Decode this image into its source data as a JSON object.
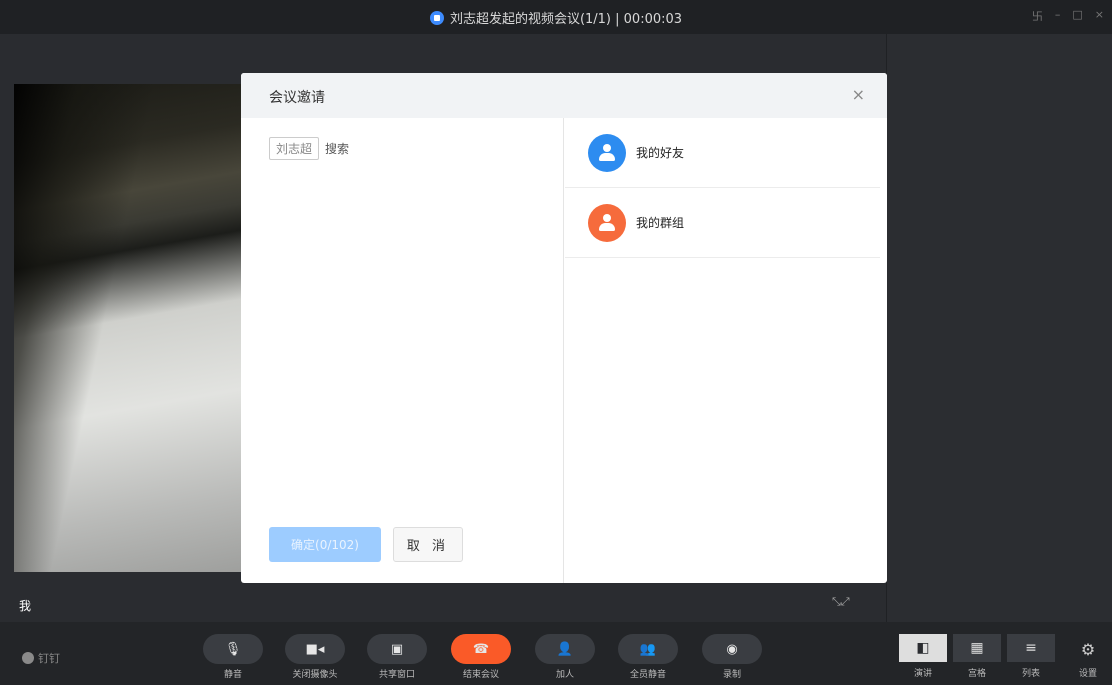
{
  "titlebar": {
    "title": "刘志超发起的视频会议(1/1) | 00:00:03",
    "window_controls": [
      "卐",
      "–",
      "□",
      "×"
    ]
  },
  "video": {
    "self_label": "我"
  },
  "bottombar": {
    "brand": "钉钉",
    "controls": [
      {
        "label": "静音",
        "icon": "microphone-icon"
      },
      {
        "label": "关闭摄像头",
        "icon": "camera-icon"
      },
      {
        "label": "共享窗口",
        "icon": "share-window-icon"
      },
      {
        "label": "结束会议",
        "icon": "hangup-icon"
      },
      {
        "label": "加人",
        "icon": "add-person-icon"
      },
      {
        "label": "全员静音",
        "icon": "mute-all-icon"
      },
      {
        "label": "录制",
        "icon": "record-icon"
      }
    ],
    "layouts": [
      {
        "label": "演讲",
        "icon": "speaker-layout-icon",
        "active": true
      },
      {
        "label": "宫格",
        "icon": "grid-layout-icon",
        "active": false
      },
      {
        "label": "列表",
        "icon": "list-layout-icon",
        "active": false
      }
    ],
    "settings_label": "设置"
  },
  "dialog": {
    "title": "会议邀请",
    "selected_chip": "刘志超",
    "search_placeholder": "搜索",
    "confirm_label": "确定(0/102)",
    "cancel_label": "取 消",
    "groups": [
      {
        "name": "我的好友",
        "color": "#2d8cf0"
      },
      {
        "name": "我的群组",
        "color": "#f66b3c"
      }
    ]
  }
}
